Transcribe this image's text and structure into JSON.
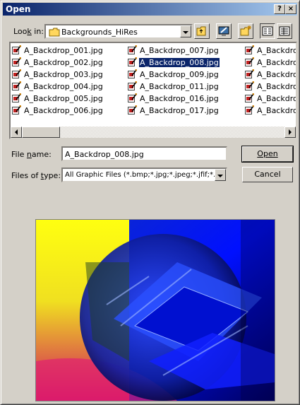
{
  "window": {
    "title": "Open",
    "help_label": "?",
    "close_label": "×"
  },
  "look_in": {
    "label": "Look in:",
    "value": "Backgrounds_HiRes"
  },
  "toolbar": {
    "icons": [
      "up-one-level-icon",
      "desktop-icon",
      "new-folder-icon",
      "list-view-icon",
      "details-view-icon"
    ]
  },
  "files": {
    "col1": [
      "A_Backdrop_001.jpg",
      "A_Backdrop_002.jpg",
      "A_Backdrop_003.jpg",
      "A_Backdrop_004.jpg",
      "A_Backdrop_005.jpg",
      "A_Backdrop_006.jpg"
    ],
    "col2": [
      "A_Backdrop_007.jpg",
      "A_Backdrop_008.jpg",
      "A_Backdrop_009.jpg",
      "A_Backdrop_011.jpg",
      "A_Backdrop_016.jpg",
      "A_Backdrop_017.jpg"
    ],
    "col3": [
      "A_Backdrop",
      "A_Backdrop",
      "A_Backdrop",
      "A_Backdrop",
      "A_Backdrop",
      "A_Backdrop"
    ],
    "selected": "A_Backdrop_008.jpg"
  },
  "file_name": {
    "label": "File name:",
    "value": "A_Backdrop_008.jpg"
  },
  "files_of_type": {
    "label": "Files of type:",
    "value": "All Graphic Files (*.bmp;*.jpg;*.jpeg;*.jfif;*.wpg"
  },
  "buttons": {
    "open": "Open",
    "cancel": "Cancel"
  },
  "colors": {
    "title_start": "#0a246a",
    "title_end": "#a6caf0",
    "selection": "#0a246a",
    "face": "#d4d0c8"
  }
}
